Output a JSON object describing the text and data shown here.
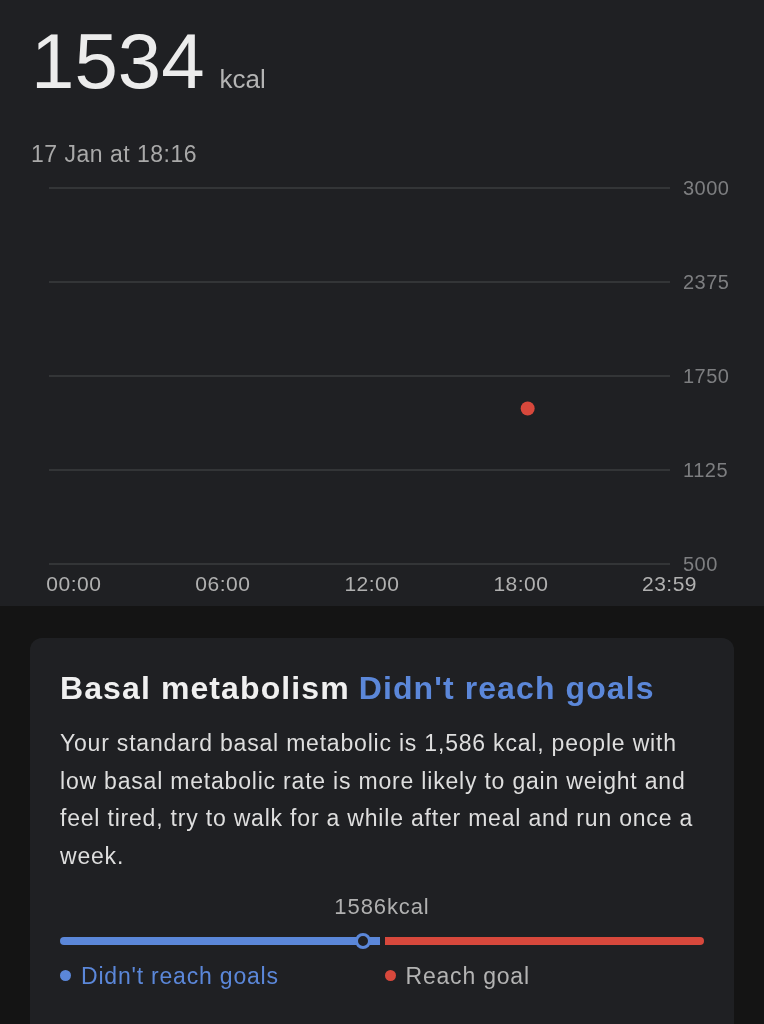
{
  "summary": {
    "value": "1534",
    "unit": "kcal",
    "timestamp": "17 Jan at 18:16"
  },
  "chart": {
    "chart_data": {
      "type": "scatter",
      "x": [
        18.27
      ],
      "series": [
        {
          "color": "#d7483c",
          "values": [
            1534
          ]
        }
      ],
      "xlim": [
        -1,
        24
      ],
      "ylim": [
        500,
        3000
      ],
      "xticks": [
        {
          "value": 0,
          "label": "00:00"
        },
        {
          "value": 6,
          "label": "06:00"
        },
        {
          "value": 12,
          "label": "12:00"
        },
        {
          "value": 18,
          "label": "18:00"
        },
        {
          "value": 23.98,
          "label": "23:59"
        }
      ],
      "yticks": [
        500,
        1125,
        1750,
        2375,
        3000
      ],
      "grid": true
    }
  },
  "card": {
    "title": "Basal metabolism",
    "status": "Didn't reach goals",
    "body": "Your standard basal metabolic is 1,586 kcal, people with low basal metabolic rate is more likely to gain weight and feel tired, try to walk for a while after meal and run once a week.",
    "gauge": {
      "label": "1586kcal",
      "level": 0.47
    },
    "legend": [
      {
        "label": "Didn't reach goals",
        "color": "#5b87d9",
        "active": true
      },
      {
        "label": "Reach goal",
        "color": "#d7483c",
        "active": false
      }
    ]
  }
}
